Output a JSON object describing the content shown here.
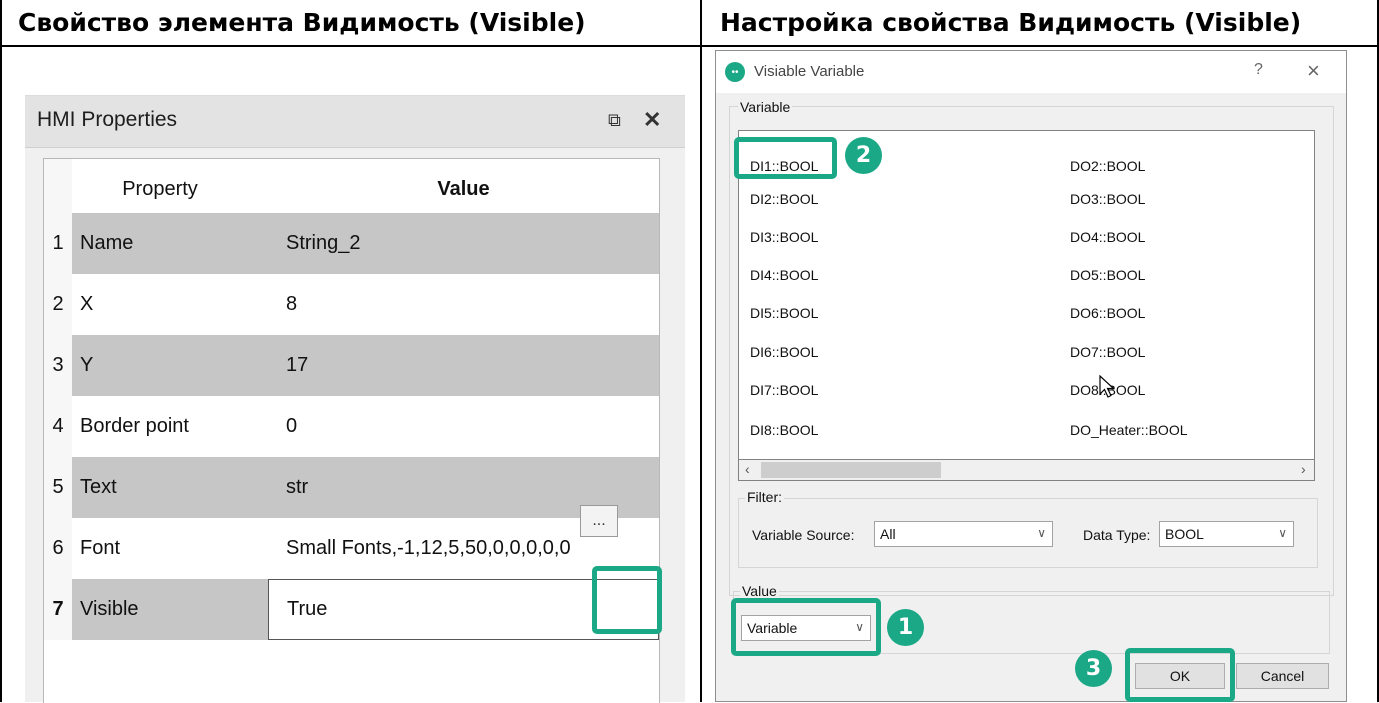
{
  "headers": {
    "left": "Свойство элемента Видимость (Visible)",
    "right": "Настройка свойства Видимость (Visible)"
  },
  "hmi_panel": {
    "title": "HMI Properties",
    "columns": {
      "property": "Property",
      "value": "Value"
    },
    "rows": [
      {
        "num": "1",
        "property": "Name",
        "value": "String_2"
      },
      {
        "num": "2",
        "property": "X",
        "value": "8"
      },
      {
        "num": "3",
        "property": "Y",
        "value": "17"
      },
      {
        "num": "4",
        "property": "Border point",
        "value": "0"
      },
      {
        "num": "5",
        "property": "Text",
        "value": "str"
      },
      {
        "num": "6",
        "property": "Font",
        "value": "Small Fonts,-1,12,5,50,0,0,0,0,0"
      },
      {
        "num": "7",
        "property": "Visible",
        "value": "True"
      }
    ],
    "ellipsis_label": "..."
  },
  "dialog": {
    "title": "Visiable Variable",
    "help": "?",
    "close": "×",
    "variable_group_label": "Variable",
    "variables_left": [
      "DI1::BOOL",
      "DI2::BOOL",
      "DI3::BOOL",
      "DI4::BOOL",
      "DI5::BOOL",
      "DI6::BOOL",
      "DI7::BOOL",
      "DI8::BOOL"
    ],
    "variables_right": [
      "DO2::BOOL",
      "DO3::BOOL",
      "DO4::BOOL",
      "DO5::BOOL",
      "DO6::BOOL",
      "DO7::BOOL",
      "DO8::BOOL",
      "DO_Heater::BOOL"
    ],
    "filter_label": "Filter:",
    "variable_source_label": "Variable Source:",
    "variable_source_value": "All",
    "data_type_label": "Data Type:",
    "data_type_value": "BOOL",
    "value_group_label": "Value",
    "value_select": "Variable",
    "ok": "OK",
    "cancel": "Cancel"
  },
  "badges": {
    "one": "1",
    "two": "2",
    "three": "3"
  },
  "accent_color": "#1ba886"
}
